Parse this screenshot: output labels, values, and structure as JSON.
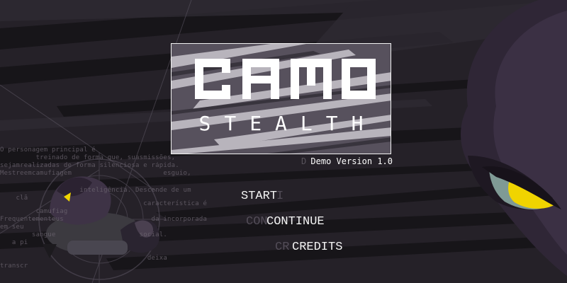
{
  "game": {
    "title": "CAMO",
    "subtitle": "STEALTH",
    "version": "Demo Version 1.0",
    "version_ghost": "D"
  },
  "menu": {
    "start": "START",
    "continue": "CONTINUE",
    "credits": "CREDITS",
    "start_ghost": "I",
    "continue_ghost": "CON",
    "credits_ghost": "CR"
  },
  "lore": [
    "O personagem principal é",
    "         treinado de forma que, suasmissões,",
    "sejamrealizadas de forma silenciosa e rápida.",
    "Mestreemcamufiagem                       esguio,",
    "                    inteligência. Descende de um",
    "    clã",
    "                                    característica é",
    "         camufiag",
    "Frequentementeus                      da incorporada",
    "em seu",
    "        sangue                     social.",
    "   a pi",
    "                                     deixa",
    "transcr"
  ],
  "colors": {
    "background": "#221f24",
    "logo_stripe": "#f2f2f2",
    "logo_fill": "#5b5561",
    "creature_body": "#3a3040",
    "eye": "#f0d400"
  }
}
